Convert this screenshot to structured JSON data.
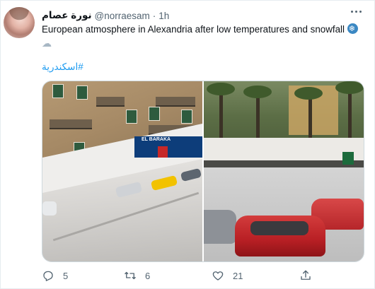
{
  "tweet": {
    "display_name": "نورة عصام",
    "handle": "@norraesam",
    "separator": "·",
    "time": "1h",
    "text": "European atmosphere in Alexandria after low temperatures and snowfall",
    "hashtag": "#اسكندرية"
  },
  "media": {
    "left_photo": {
      "shop_sign": "EL BARAKA"
    }
  },
  "actions": {
    "reply_count": "5",
    "retweet_count": "6",
    "like_count": "21"
  },
  "icons": {
    "more": "more-dots-icon",
    "reply": "reply-icon",
    "retweet": "retweet-icon",
    "like": "heart-icon",
    "share": "share-icon",
    "emoji_snow": "snowflake-emoji",
    "emoji_cloud": "cloud-snow-emoji"
  },
  "colors": {
    "accent": "#1d9bf0",
    "text": "#0f1419",
    "secondary": "#536471"
  }
}
